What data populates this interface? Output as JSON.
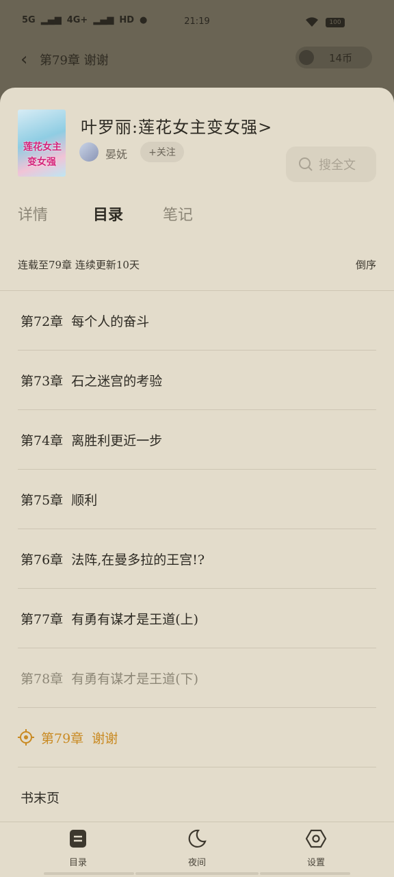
{
  "statusbar": {
    "network1": "5G",
    "network2": "4G+",
    "hd": "HD",
    "time": "21:19",
    "battery": "100"
  },
  "reader": {
    "back_icon": "chevron-left-icon",
    "chapter": "第79章 谢谢",
    "coins": "14币"
  },
  "book": {
    "title": "叶罗丽:莲花女主变女强>",
    "author": "晏妩",
    "follow": "+关注",
    "cover_text_1": "莲花女主",
    "cover_text_2": "变女强"
  },
  "search": {
    "placeholder": "搜全文"
  },
  "tabs": [
    {
      "label": "详情"
    },
    {
      "label": "目录"
    },
    {
      "label": "笔记"
    }
  ],
  "info": {
    "status": "连载至79章 连续更新10天",
    "order": "倒序"
  },
  "chapters": [
    {
      "num": "第72章",
      "title": "每个人的奋斗"
    },
    {
      "num": "第73章",
      "title": "石之迷宫的考验"
    },
    {
      "num": "第74章",
      "title": "离胜利更近一步"
    },
    {
      "num": "第75章",
      "title": "顺利"
    },
    {
      "num": "第76章",
      "title": "法阵,在曼多拉的王宫!?"
    },
    {
      "num": "第77章",
      "title": "有勇有谋才是王道(上)"
    },
    {
      "num": "第78章",
      "title": "有勇有谋才是王道(下)"
    },
    {
      "num": "第79章",
      "title": "谢谢"
    }
  ],
  "end_page": "书末页",
  "nav": [
    {
      "label": "目录",
      "icon": "toc-icon"
    },
    {
      "label": "夜间",
      "icon": "moon-icon"
    },
    {
      "label": "设置",
      "icon": "settings-icon"
    }
  ],
  "colors": {
    "accent": "#c98a22",
    "sheet": "#e3dccb"
  }
}
